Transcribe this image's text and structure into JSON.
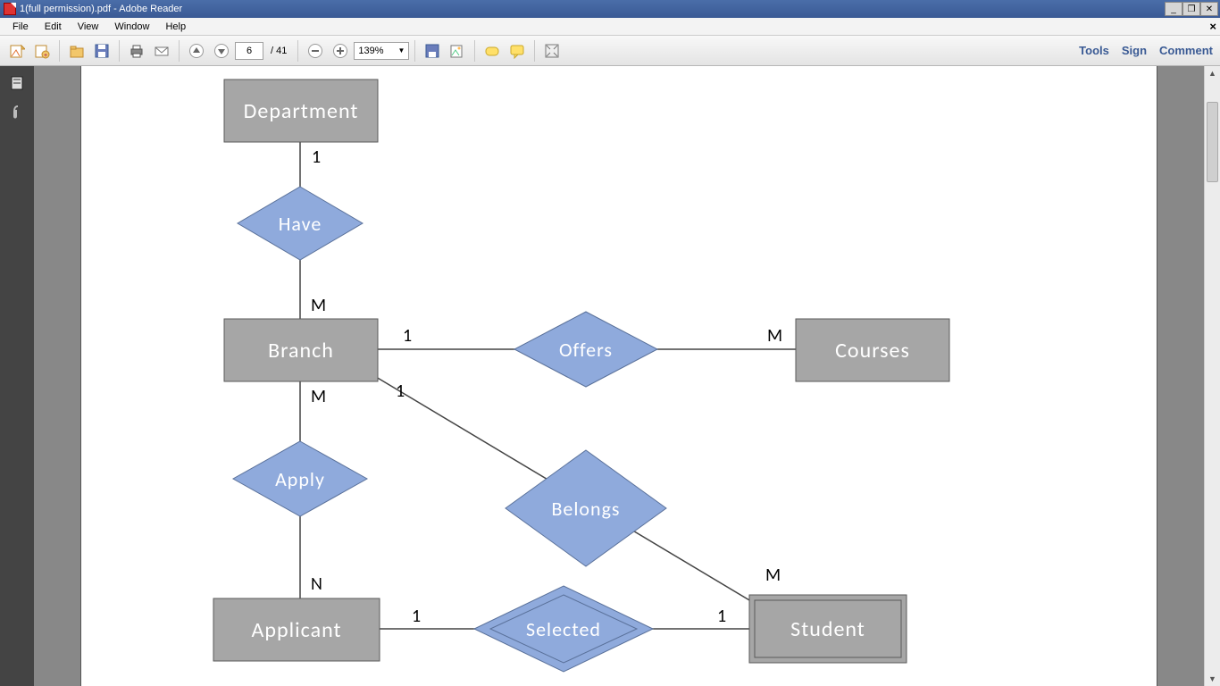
{
  "window": {
    "title": "1(full permission).pdf - Adobe Reader"
  },
  "menu": {
    "items": [
      "File",
      "Edit",
      "View",
      "Window",
      "Help"
    ]
  },
  "toolbar": {
    "page_current": "6",
    "page_total": "/ 41",
    "zoom": "139%",
    "links": {
      "tools": "Tools",
      "sign": "Sign",
      "comment": "Comment"
    }
  },
  "diagram": {
    "entities": {
      "department": "Department",
      "branch": "Branch",
      "courses": "Courses",
      "applicant": "Applicant",
      "student": "Student"
    },
    "relations": {
      "have": "Have",
      "offers": "Offers",
      "apply": "Apply",
      "belongs": "Belongs",
      "selected": "Selected"
    },
    "cardinalities": {
      "dep_have": "1",
      "have_branch": "M",
      "branch_offers": "1",
      "offers_courses": "M",
      "branch_apply": "M",
      "apply_applicant": "N",
      "branch_belongs": "1",
      "belongs_student": "M",
      "applicant_selected": "1",
      "selected_student": "1"
    }
  }
}
